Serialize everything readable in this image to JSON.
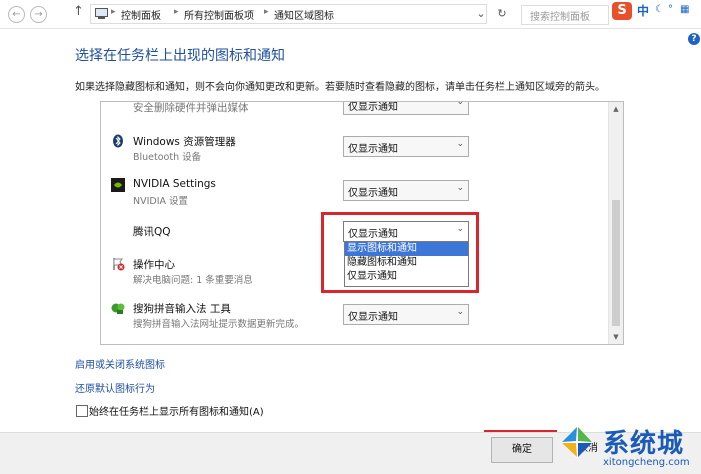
{
  "toolbar": {
    "back": "←",
    "forward": "→",
    "up": "↑",
    "breadcrumb": [
      "控制面板",
      "所有控制面板项",
      "通知区域图标"
    ],
    "search_placeholder": "搜索控制面板"
  },
  "ime": {
    "logo": "S",
    "text": "中"
  },
  "page": {
    "title": "选择在任务栏上出现的图标和通知",
    "description": "如果选择隐藏图标和通知，则不会向你通知更改和更新。若要随时查看隐藏的图标，请单击任务栏上通知区域旁的箭头。"
  },
  "rows": [
    {
      "name": "安全删除硬件并弹出媒体",
      "sub": "",
      "value": "仅显示通知"
    },
    {
      "name": "Windows 资源管理器",
      "sub": "Bluetooth 设备",
      "value": "仅显示通知"
    },
    {
      "name": "NVIDIA Settings",
      "sub": "NVIDIA 设置",
      "value": "仅显示通知"
    },
    {
      "name": "腾讯QQ",
      "sub": "",
      "value": "仅显示通知"
    },
    {
      "name": "操作中心",
      "sub": "解决电脑问题: 1 条重要消息",
      "value": ""
    },
    {
      "name": "搜狗拼音输入法 工具",
      "sub": "搜狗拼音输入法网址提示数据更新完成。",
      "value": "仅显示通知"
    }
  ],
  "dropdown_options": [
    "显示图标和通知",
    "隐藏图标和通知",
    "仅显示通知"
  ],
  "dropdown_highlight_index": 0,
  "links": {
    "system_icons": "启用或关闭系统图标",
    "restore": "还原默认图标行为"
  },
  "always_show": {
    "label": "始终在任务栏上显示所有图标和通知(A)",
    "checked": false
  },
  "buttons": {
    "ok": "确定",
    "cancel": "取消"
  },
  "watermark": {
    "name": "系统城",
    "url": "xitongcheng.com"
  },
  "colors": {
    "accent": "#1e4fa1",
    "highlight": "#d9262c",
    "selection": "#3d76d6"
  }
}
